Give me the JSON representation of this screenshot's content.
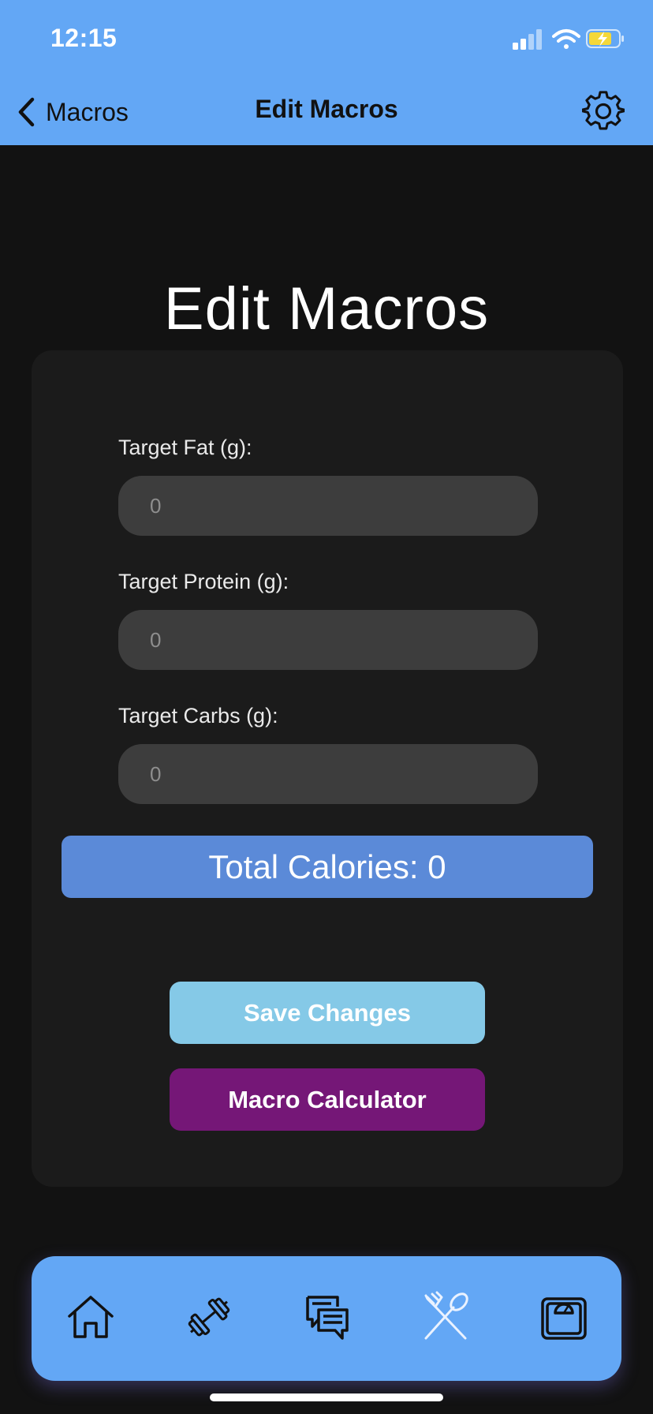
{
  "status_bar": {
    "time": "12:15"
  },
  "nav": {
    "back_label": "Macros",
    "title": "Edit Macros"
  },
  "page": {
    "heading": "Edit Macros"
  },
  "form": {
    "fat": {
      "label": "Target Fat (g):",
      "placeholder": "0"
    },
    "protein": {
      "label": "Target Protein (g):",
      "placeholder": "0"
    },
    "carbs": {
      "label": "Target Carbs (g):",
      "placeholder": "0"
    }
  },
  "total_calories": "Total Calories: 0",
  "buttons": {
    "save": "Save Changes",
    "calculator": "Macro Calculator"
  },
  "tabbar": {
    "tabs": [
      {
        "icon": "home-icon"
      },
      {
        "icon": "dumbbell-icon"
      },
      {
        "icon": "chat-icon"
      },
      {
        "icon": "fork-spoon-icon"
      },
      {
        "icon": "scale-icon"
      }
    ]
  },
  "colors": {
    "header": "#63a7f5",
    "background": "#121212",
    "card": "#1b1b1b",
    "input": "#3d3d3d",
    "total_bar": "#5b8ad8",
    "save_button": "#85c9e7",
    "calculator_button": "#751777"
  }
}
